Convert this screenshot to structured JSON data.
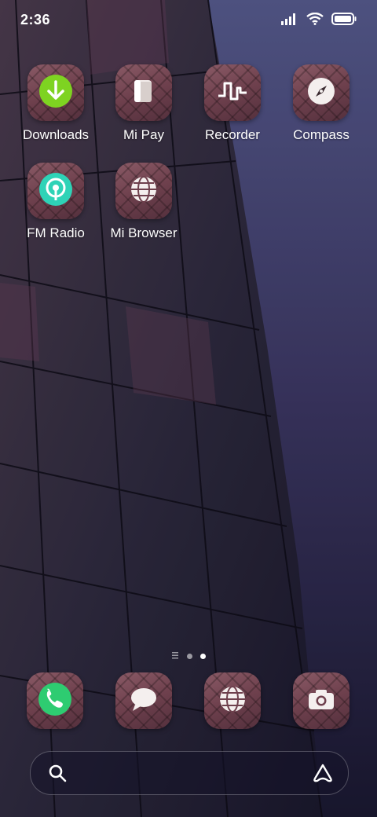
{
  "status_bar": {
    "time": "2:36",
    "icons": [
      "signal-icon",
      "wifi-icon",
      "battery-icon"
    ]
  },
  "home_apps": [
    {
      "label": "Downloads",
      "icon": "download-icon"
    },
    {
      "label": "Mi Pay",
      "icon": "wallet-icon"
    },
    {
      "label": "Recorder",
      "icon": "waveform-icon"
    },
    {
      "label": "Compass",
      "icon": "compass-icon"
    },
    {
      "label": "FM Radio",
      "icon": "radio-icon"
    },
    {
      "label": "Mi Browser",
      "icon": "globe-icon"
    }
  ],
  "page_indicator": {
    "pages": [
      "list",
      "dot",
      "dot"
    ],
    "current": 3
  },
  "dock": [
    {
      "app": "Phone",
      "icon": "phone-icon"
    },
    {
      "app": "Messages",
      "icon": "chat-icon"
    },
    {
      "app": "Browser",
      "icon": "globe-icon"
    },
    {
      "app": "Camera",
      "icon": "camera-icon"
    }
  ],
  "search": {
    "icon": "search-icon",
    "assistant_icon": "assistant-icon"
  },
  "colors": {
    "downloads_green": "#7ed321",
    "radio_teal": "#2ed3b7",
    "phone_green": "#2ecc71",
    "tile_base": "#6e404d"
  }
}
